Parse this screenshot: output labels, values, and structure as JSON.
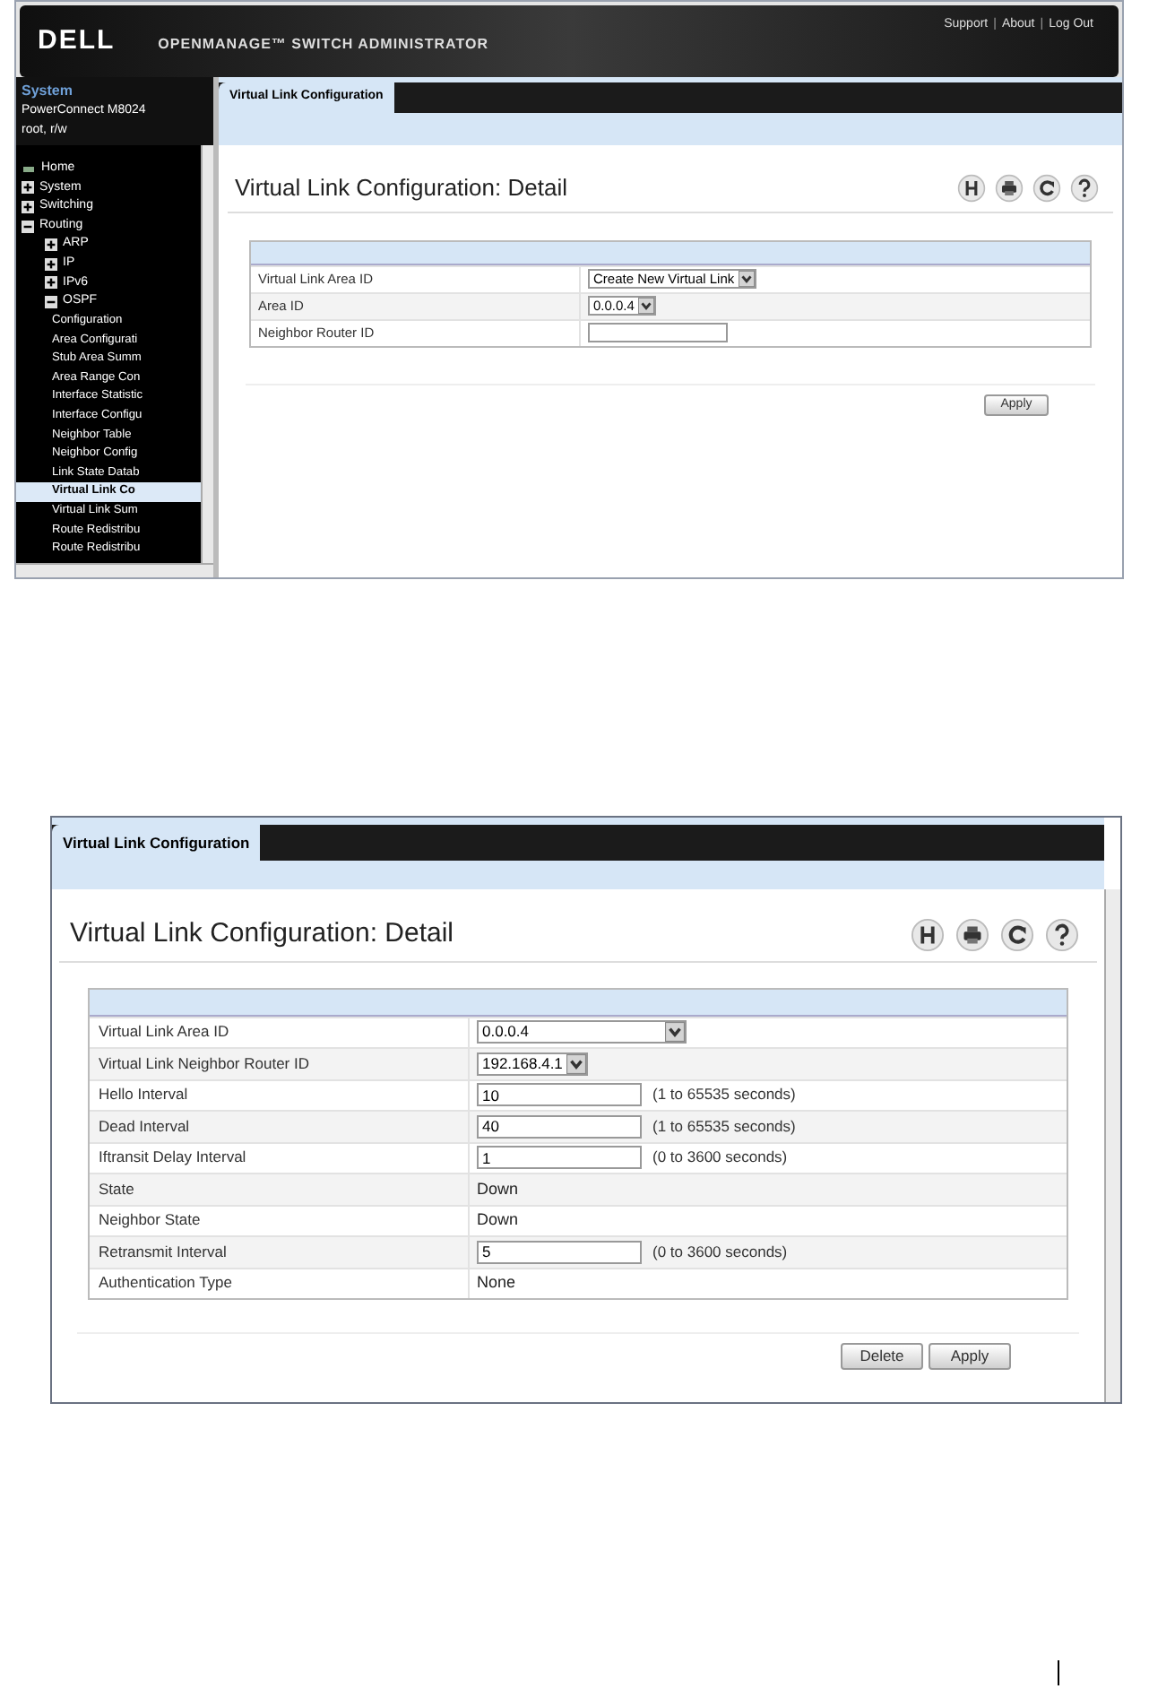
{
  "screenshot_1": {
    "header": {
      "logo": "DELL",
      "product": "OPENMANAGE™ SWITCH ADMINISTRATOR",
      "links": [
        "Support",
        "About",
        "Log Out"
      ],
      "separator": "|"
    },
    "sidebar": {
      "title": "System",
      "device": "PowerConnect M8024",
      "user": "root, r/w",
      "tree": [
        {
          "kind": "home",
          "label": "Home"
        },
        {
          "kind": "folder",
          "label": "System",
          "expanded": false
        },
        {
          "kind": "folder",
          "label": "Switching",
          "expanded": false
        },
        {
          "kind": "folder",
          "label": "Routing",
          "expanded": true,
          "children": [
            {
              "kind": "folder",
              "label": "ARP",
              "expanded": false
            },
            {
              "kind": "folder",
              "label": "IP",
              "expanded": false
            },
            {
              "kind": "folder",
              "label": "IPv6",
              "expanded": false
            },
            {
              "kind": "folder",
              "label": "OSPF",
              "expanded": true,
              "children": [
                {
                  "kind": "page",
                  "label": "Configuration",
                  "selected": false
                },
                {
                  "kind": "page",
                  "label": "Area Configurati",
                  "selected": false
                },
                {
                  "kind": "page",
                  "label": "Stub Area Summ",
                  "selected": false
                },
                {
                  "kind": "page",
                  "label": "Area Range Con",
                  "selected": false
                },
                {
                  "kind": "page",
                  "label": "Interface Statistic",
                  "selected": false
                },
                {
                  "kind": "page",
                  "label": "Interface Configu",
                  "selected": false
                },
                {
                  "kind": "page",
                  "label": "Neighbor Table",
                  "selected": false
                },
                {
                  "kind": "page",
                  "label": "Neighbor Config",
                  "selected": false
                },
                {
                  "kind": "page",
                  "label": "Link State Datab",
                  "selected": false
                },
                {
                  "kind": "page",
                  "label": "Virtual Link Co",
                  "selected": true
                },
                {
                  "kind": "page",
                  "label": "Virtual Link Sum",
                  "selected": false
                },
                {
                  "kind": "page",
                  "label": "Route Redistribu",
                  "selected": false
                },
                {
                  "kind": "page",
                  "label": "Route Redistribu",
                  "selected": false
                }
              ]
            }
          ]
        }
      ]
    },
    "tabs": [
      {
        "label": "Virtual Link Configuration",
        "selected": true
      }
    ],
    "heading": "Virtual Link Configuration: Detail",
    "rows": [
      {
        "kind": "select",
        "label": "Virtual Link Area ID",
        "value": "Create New Virtual Link"
      },
      {
        "kind": "select",
        "label": "Area ID",
        "value": "0.0.0.4"
      },
      {
        "kind": "input",
        "label": "Neighbor Router ID",
        "value": ""
      }
    ],
    "buttons": [
      "Apply"
    ]
  },
  "screenshot_2": {
    "tabs": [
      {
        "label": "Virtual Link Configuration",
        "selected": true
      }
    ],
    "heading": "Virtual Link Configuration: Detail",
    "rows": [
      {
        "kind": "select",
        "label": "Virtual Link Area ID",
        "value": "0.0.0.4"
      },
      {
        "kind": "select",
        "label": "Virtual Link Neighbor Router ID",
        "value": "192.168.4.1"
      },
      {
        "kind": "input",
        "label": "Hello Interval",
        "value": "10",
        "hint": "(1 to 65535 seconds)"
      },
      {
        "kind": "input",
        "label": "Dead Interval",
        "value": "40",
        "hint": "(1 to 65535 seconds)"
      },
      {
        "kind": "input",
        "label": "Iftransit Delay Interval",
        "value": "1",
        "hint": "(0 to 3600 seconds)"
      },
      {
        "kind": "text",
        "label": "State",
        "value": "Down"
      },
      {
        "kind": "text",
        "label": "Neighbor State",
        "value": "Down"
      },
      {
        "kind": "input",
        "label": "Retransmit Interval",
        "value": "5",
        "hint": "(0 to 3600 seconds)"
      },
      {
        "kind": "text",
        "label": "Authentication Type",
        "value": "None"
      }
    ],
    "buttons": [
      "Delete",
      "Apply"
    ]
  }
}
